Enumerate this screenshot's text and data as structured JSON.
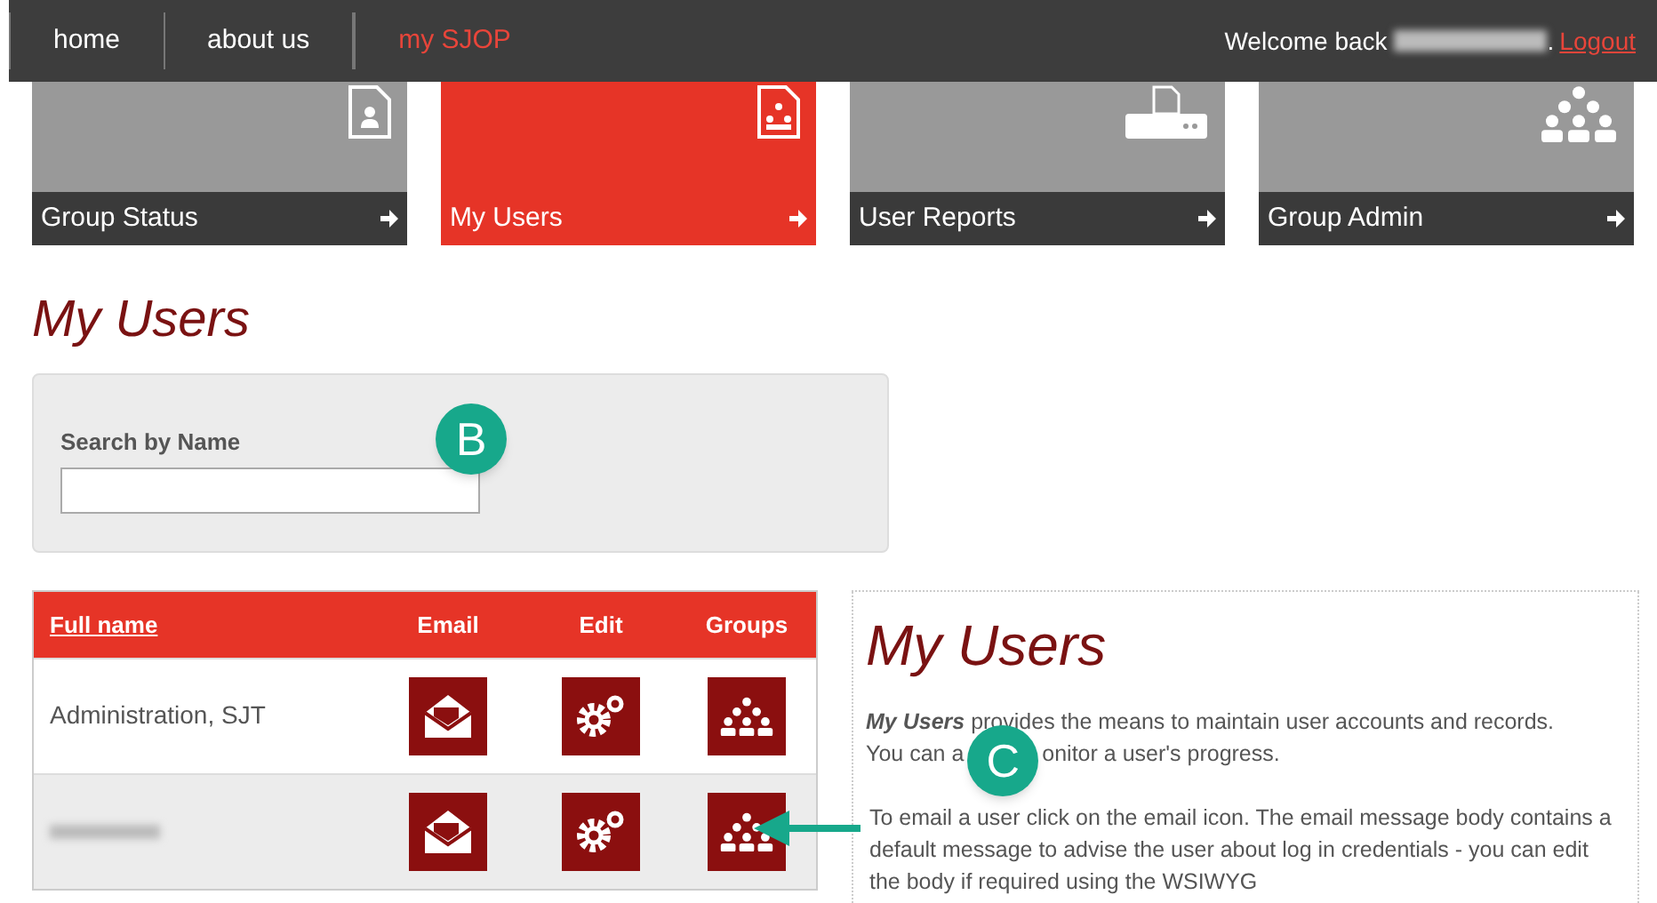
{
  "nav": {
    "items": [
      {
        "label": "home",
        "selected": false
      },
      {
        "label": "about us",
        "selected": false
      },
      {
        "label": "my SJOP",
        "selected": true
      }
    ],
    "welcome": "Welcome back",
    "name_blurred": true,
    "after_name": ".",
    "logout": "Logout"
  },
  "tiles": [
    {
      "label": "Group Status",
      "selected": false,
      "kind": "status"
    },
    {
      "label": "My Users",
      "selected": true,
      "kind": "users"
    },
    {
      "label": "User Reports",
      "selected": false,
      "kind": "reports"
    },
    {
      "label": "Group Admin",
      "selected": false,
      "kind": "admin"
    }
  ],
  "heading": "My Users",
  "search": {
    "label": "Search by Name"
  },
  "table": {
    "columns": [
      "Full name",
      "Email",
      "Edit",
      "Groups"
    ],
    "rows": [
      {
        "name": "Administration, SJT",
        "name_blurred": false
      },
      {
        "name_blurred": true
      }
    ]
  },
  "help": {
    "title": "My Users",
    "intro": "**My Users** provides the means to maintain user accounts and records.",
    "line_before_callout": "You can a",
    "line_after_callout": "onitor a user's progress.",
    "paragraph": "To email a user click on the email icon. The email message body contains a default message to advise the user about log in credentials - you can edit the body if required using the WSIWYG"
  },
  "callouts": [
    {
      "label": "B",
      "arrow": false
    },
    {
      "label": "C",
      "arrow": true
    }
  ]
}
